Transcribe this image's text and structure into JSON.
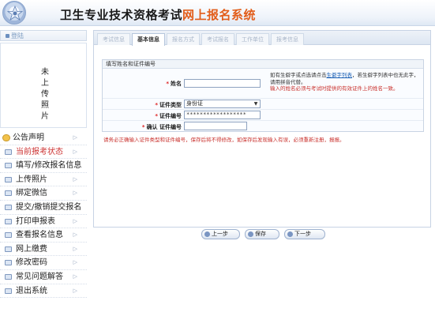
{
  "header": {
    "title_main": "卫生专业技术资格考试",
    "title_highlight": "网上报名系统"
  },
  "sidebar": {
    "status_label": "登陆",
    "photo_text": "未上传照片",
    "items": [
      {
        "label": "公告声明",
        "icon": "announcement-icon"
      },
      {
        "label": "当前报考状态",
        "icon": "status-icon"
      },
      {
        "label": "填写/修改报名信息",
        "icon": "edit-icon"
      },
      {
        "label": "上传照片",
        "icon": "photo-icon"
      },
      {
        "label": "绑定微信",
        "icon": "wechat-icon"
      },
      {
        "label": "提交/撤销提交报名",
        "icon": "submit-icon"
      },
      {
        "label": "打印申报表",
        "icon": "print-icon"
      },
      {
        "label": "查看报名信息",
        "icon": "view-icon"
      },
      {
        "label": "网上缴费",
        "icon": "payment-icon"
      },
      {
        "label": "修改密码",
        "icon": "password-icon"
      },
      {
        "label": "常见问题解答",
        "icon": "faq-icon"
      },
      {
        "label": "退出系统",
        "icon": "logout-icon"
      }
    ]
  },
  "tabs": [
    "考试信息",
    "基本信息",
    "报名方式",
    "考试报名",
    "工作单位",
    "报考信息"
  ],
  "active_tab": 1,
  "form": {
    "section_title": "填写姓名和证件编号",
    "name_label": "姓名",
    "name_value": "",
    "id_type_label": "证件类型",
    "id_type_value": "身份证",
    "id_number_label": "证件编号",
    "id_number_value": "******************",
    "confirm_label": "确认 证件编号",
    "confirm_value": "",
    "hint_before_link": "如有生僻字或点选请点击",
    "hint_link": "生僻字列表",
    "hint_after_link": "，若生僻字列表中也无此字，请用拼音代替。",
    "hint_warning": "输入的姓名必须与考试时提供的有效证件上的姓名一致。",
    "notice": "请务必正确输入证件类型和证件编号，保存后将不得修改，如保存后发现输入有误，必须重新注册，报报。"
  },
  "buttons": {
    "prev": "上一步",
    "save": "保存",
    "next": "下一步"
  }
}
